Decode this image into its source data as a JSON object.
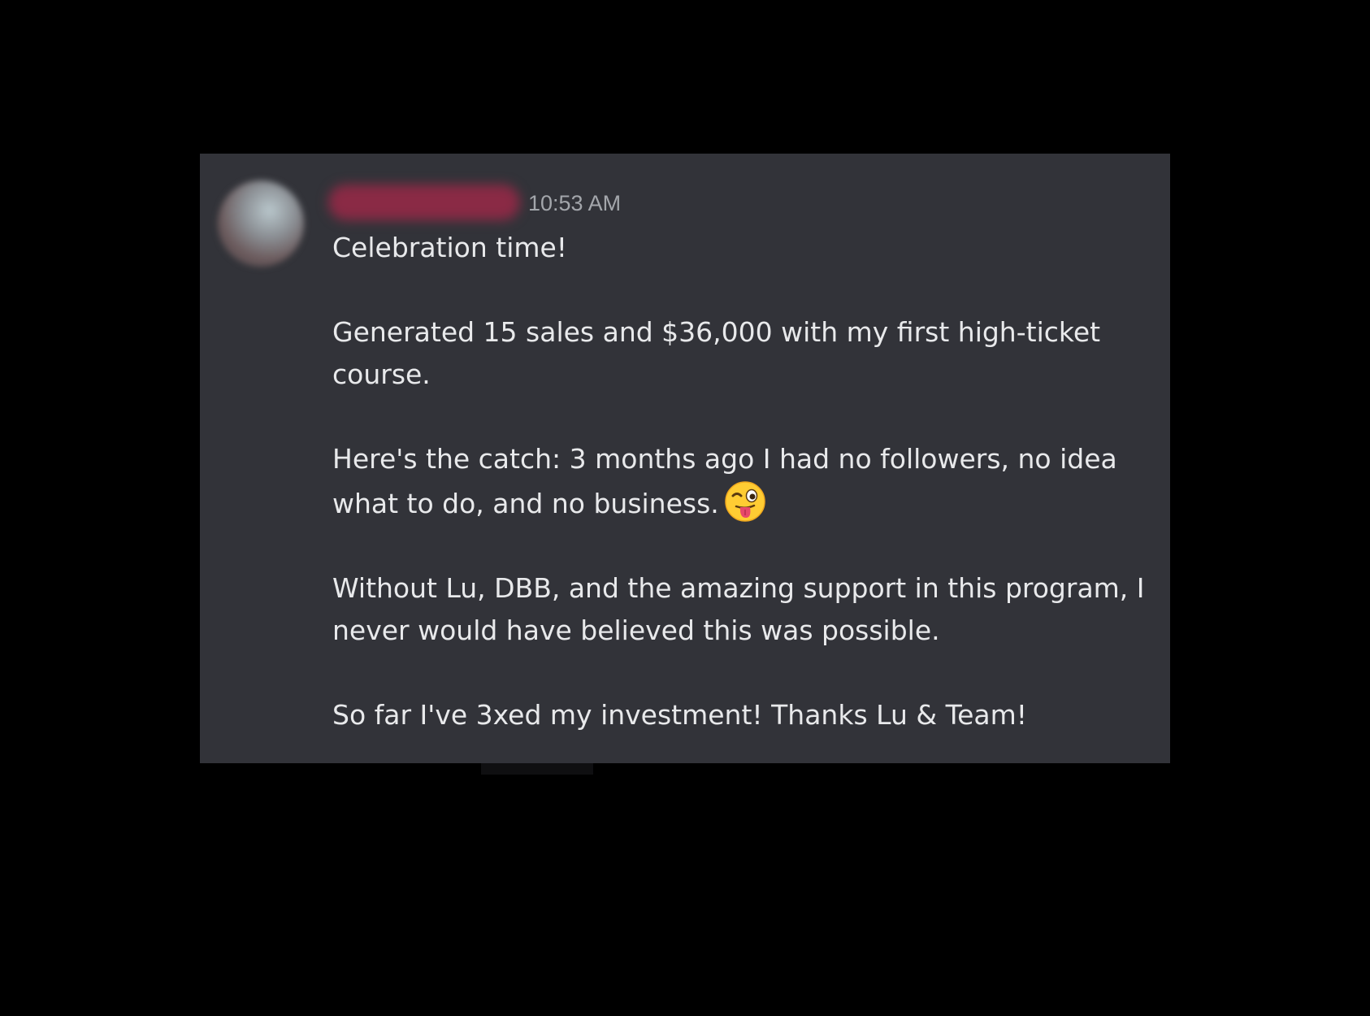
{
  "message": {
    "timestamp": "10:53 AM",
    "paragraphs": [
      "Celebration time!",
      "Generated 15 sales and $36,000 with my first high-ticket course.",
      "Here's the catch: 3 months ago I had no followers, no idea what to do, and no business.",
      "Without Lu, DBB, and the amazing support in this program, I never would have believed this was possible.",
      "So far I've 3xed my investment! Thanks Lu & Team!"
    ],
    "emoji_icon": "winking-face-with-tongue-icon"
  },
  "colors": {
    "page_background": "#000000",
    "card_background": "#323339",
    "text": "#e8e9eb",
    "timestamp": "#a3a6ab",
    "username_blur": "#8a2a45"
  }
}
